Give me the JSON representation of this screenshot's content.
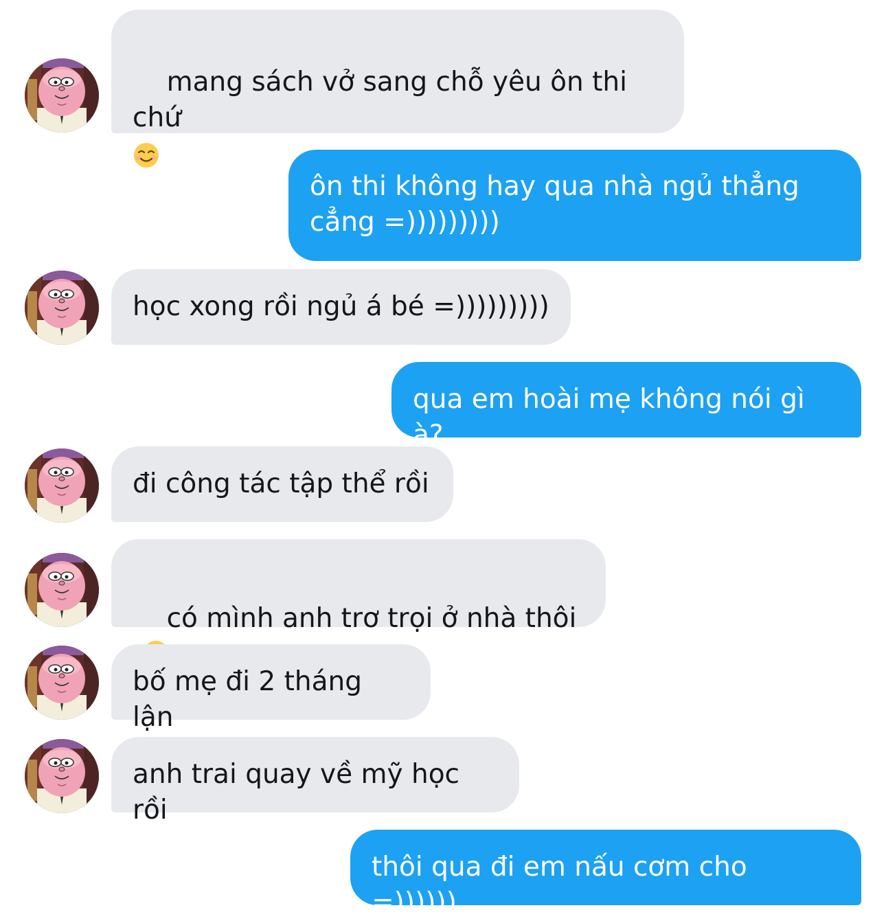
{
  "messages": [
    {
      "direction": "incoming",
      "text": "mang sách vở sang chỗ yêu ôn thi chứ",
      "emoji": "smiling-face-icon"
    },
    {
      "direction": "outgoing",
      "text": "ôn thi không hay qua nhà ngủ thẳng cẳng =)))))))))"
    },
    {
      "direction": "incoming",
      "text": "học xong rồi ngủ á bé =)))))))))"
    },
    {
      "direction": "outgoing",
      "text": "qua em hoài mẹ không nói gì à?"
    },
    {
      "direction": "incoming",
      "text": "đi công tác tập thể rồi"
    },
    {
      "direction": "incoming",
      "text": "có mình anh trơ trọi ở nhà thôi",
      "emoji": "loudly-crying-face-icon"
    },
    {
      "direction": "incoming",
      "text": "bố mẹ đi 2 tháng lận"
    },
    {
      "direction": "incoming",
      "text": "anh trai quay về mỹ học rồi"
    },
    {
      "direction": "outgoing",
      "text": "thôi qua đi em nấu cơm cho =))))))"
    }
  ],
  "colors": {
    "incoming_bubble": "#e7e9ed",
    "incoming_text": "#141619",
    "outgoing_bubble": "#1da1f2",
    "outgoing_text": "#ffffff"
  },
  "avatar_icon": "cartoon-avatar-icon"
}
